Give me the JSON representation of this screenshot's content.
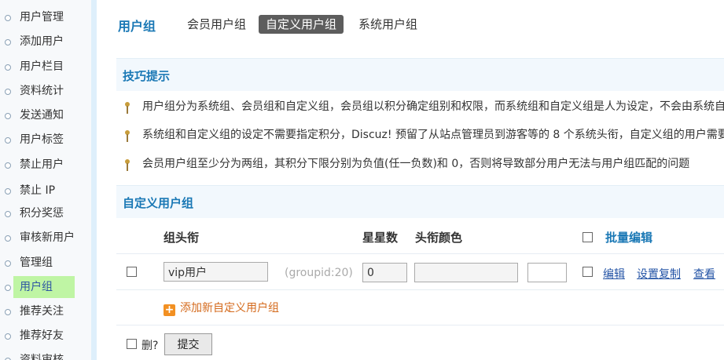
{
  "sidebar": {
    "items": [
      {
        "label": "用户管理"
      },
      {
        "label": "添加用户"
      },
      {
        "label": "用户栏目"
      },
      {
        "label": "资料统计"
      },
      {
        "label": "发送通知"
      },
      {
        "label": "用户标签"
      },
      {
        "label": "禁止用户"
      },
      {
        "label": "禁止 IP"
      },
      {
        "label": "积分奖惩"
      },
      {
        "label": "审核新用户"
      },
      {
        "label": "管理组"
      },
      {
        "label": "用户组"
      },
      {
        "label": "推荐关注"
      },
      {
        "label": "推荐好友"
      },
      {
        "label": "资料审核"
      }
    ],
    "active_index": 11
  },
  "header": {
    "title": "用户组",
    "tabs": [
      {
        "label": "会员用户组"
      },
      {
        "label": "自定义用户组"
      },
      {
        "label": "系统用户组"
      }
    ],
    "active_tab": 1
  },
  "tips": {
    "title": "技巧提示",
    "items": [
      "用户组分为系统组、会员组和自定义组，会员组以积分确定组别和权限，而系统组和自定义组是人为设定，不会由系统自行改变",
      "系统组和自定义组的设定不需要指定积分，Discuz! 预留了从站点管理员到游客等的 8 个系统头衔，自定义组的用户需要在编辑",
      "会员用户组至少分为两组，其积分下限分别为负值(任一负数)和 0，否则将导致部分用户无法与用户组匹配的问题"
    ]
  },
  "custom_groups": {
    "title": "自定义用户组",
    "columns": {
      "name": "组头衔",
      "stars": "星星数",
      "color": "头衔颜色",
      "batch_edit": "批量编辑"
    },
    "rows": [
      {
        "name": "vip用户",
        "groupid_text": "(groupid:20)",
        "stars": "0",
        "color": "",
        "actions": {
          "edit": "编辑",
          "copy": "设置复制",
          "view": "查看"
        }
      }
    ],
    "add_label": "添加新自定义用户组"
  },
  "footer": {
    "delete_label": "删?",
    "submit_label": "提交"
  },
  "colors": {
    "accent": "#1a78b5",
    "link": "#2454a6",
    "active_highlight": "#bff5a4",
    "add_orange": "#d46a1c"
  }
}
